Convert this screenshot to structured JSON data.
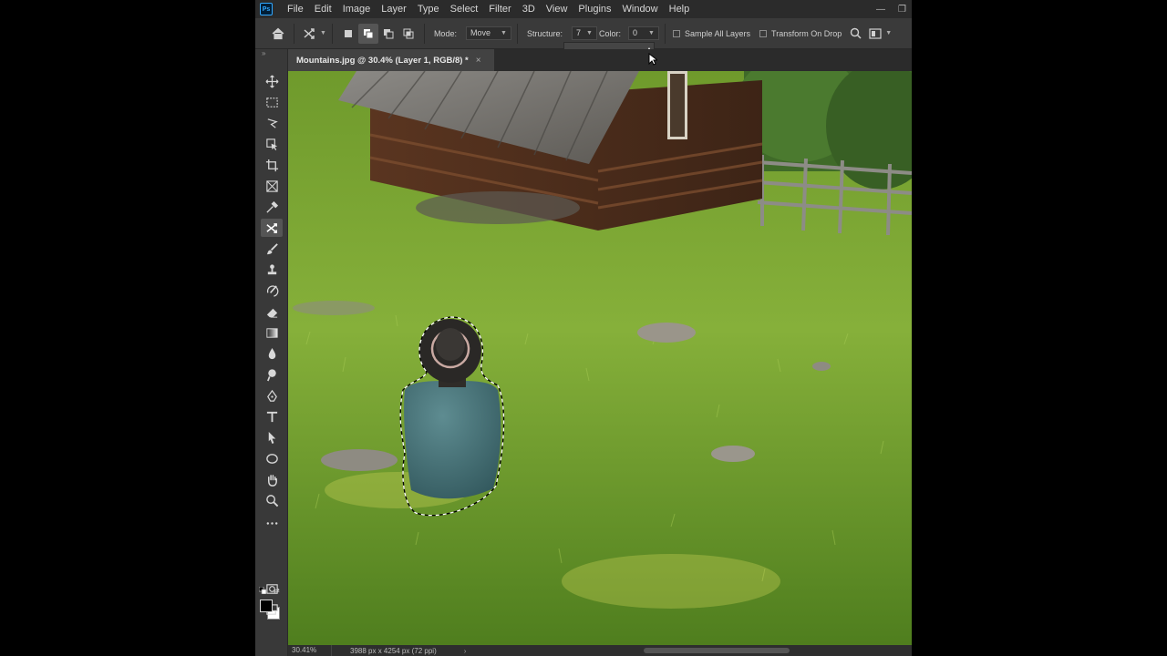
{
  "app": {
    "logo_text": "Ps"
  },
  "menu": {
    "items": [
      "File",
      "Edit",
      "Image",
      "Layer",
      "Type",
      "Select",
      "Filter",
      "3D",
      "View",
      "Plugins",
      "Window",
      "Help"
    ]
  },
  "window_controls": {
    "minimize": "—",
    "restore": "❐"
  },
  "options_bar": {
    "mode_label": "Mode:",
    "mode_value": "Move",
    "structure_label": "Structure:",
    "structure_value": "7",
    "color_label": "Color:",
    "color_value": "0",
    "sample_all_layers": "Sample All Layers",
    "transform_on_drop": "Transform On Drop",
    "structure_slider_level": 0.99
  },
  "document_tab": {
    "title": "Mountains.jpg @ 30.4% (Layer 1, RGB/8) *",
    "close": "×"
  },
  "tools": [
    "move-tool",
    "marquee-tool",
    "lasso-tool",
    "object-selection-tool",
    "crop-tool",
    "frame-tool",
    "eyedropper-tool",
    "content-aware-move-tool",
    "brush-tool",
    "clone-stamp-tool",
    "history-brush-tool",
    "eraser-tool",
    "gradient-tool",
    "blur-tool",
    "dodge-tool",
    "pen-tool",
    "type-tool",
    "path-selection-tool",
    "ellipse-tool",
    "hand-tool",
    "zoom-tool",
    "more-tools"
  ],
  "active_tool": "content-aware-move-tool",
  "colors": {
    "foreground": "#000000",
    "background": "#ffffff",
    "accent": "#31a8ff"
  },
  "status": {
    "zoom": "30.41%",
    "doc_size": "3988 px x 4254 px (72 ppi)",
    "arrow": "›"
  }
}
